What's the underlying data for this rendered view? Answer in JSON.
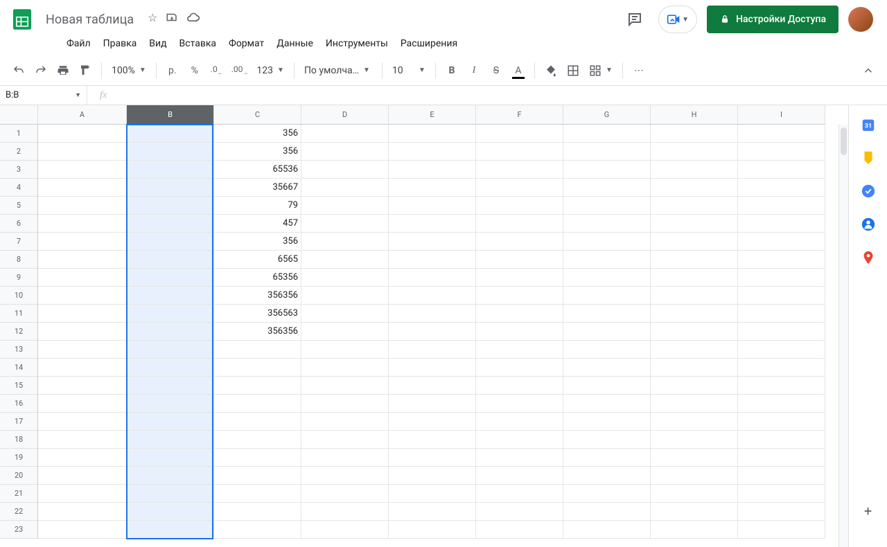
{
  "title": "Новая таблица",
  "menus": [
    "Файл",
    "Правка",
    "Вид",
    "Вставка",
    "Формат",
    "Данные",
    "Инструменты",
    "Расширения"
  ],
  "share_label": "Настройки Доступа",
  "toolbar": {
    "zoom": "100%",
    "currency": "р.",
    "percent": "%",
    "dec_down": ".0",
    "dec_up": ".00",
    "num_fmt": "123",
    "font": "По умолча…",
    "font_size": "10"
  },
  "name_box": "B:B",
  "columns": [
    "A",
    "B",
    "C",
    "D",
    "E",
    "F",
    "G",
    "H",
    "I"
  ],
  "selected_col_index": 1,
  "rows": 23,
  "data": {
    "C1": "356",
    "C2": "356",
    "C3": "65536",
    "C4": "35667",
    "C5": "79",
    "C6": "457",
    "C7": "356",
    "C8": "6565",
    "C9": "65356",
    "C10": "356356",
    "C11": "356563",
    "C12": "356356"
  }
}
